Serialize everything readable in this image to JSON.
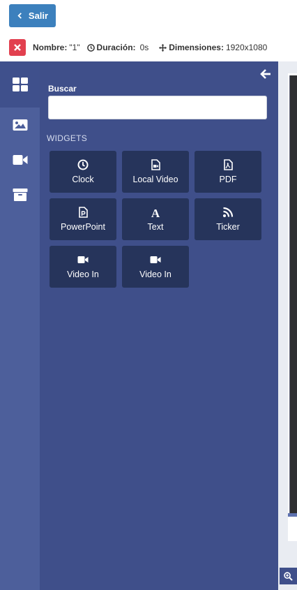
{
  "header": {
    "exit_label": "Salir",
    "name_label": "Nombre:",
    "name_value": "\"1\"",
    "duration_label": "Duración:",
    "duration_value": "0s",
    "dimensions_label": "Dimensiones:",
    "dimensions_value": "1920x1080"
  },
  "sidebar": {
    "items": [
      {
        "icon": "widgets-grid-icon",
        "active": true
      },
      {
        "icon": "image-icon",
        "active": false
      },
      {
        "icon": "video-camera-icon",
        "active": false
      },
      {
        "icon": "archive-icon",
        "active": false
      }
    ]
  },
  "panel": {
    "search_label": "Buscar",
    "search_value": "",
    "section_title": "WIDGETS",
    "widgets": [
      {
        "label": "Clock",
        "icon": "clock-icon"
      },
      {
        "label": "Local Video",
        "icon": "file-video-icon"
      },
      {
        "label": "PDF",
        "icon": "file-pdf-icon"
      },
      {
        "label": "PowerPoint",
        "icon": "file-powerpoint-icon"
      },
      {
        "label": "Text",
        "icon": "font-icon"
      },
      {
        "label": "Ticker",
        "icon": "rss-icon"
      },
      {
        "label": "Video In",
        "icon": "video-camera-icon"
      },
      {
        "label": "Video In",
        "icon": "video-camera-icon"
      }
    ]
  },
  "colors": {
    "exit_button": "#3c80bd",
    "close_badge": "#e2404f",
    "sidebar": "#4d5f9b",
    "panel": "#3f4f8a",
    "widget_tile": "#26345b"
  }
}
